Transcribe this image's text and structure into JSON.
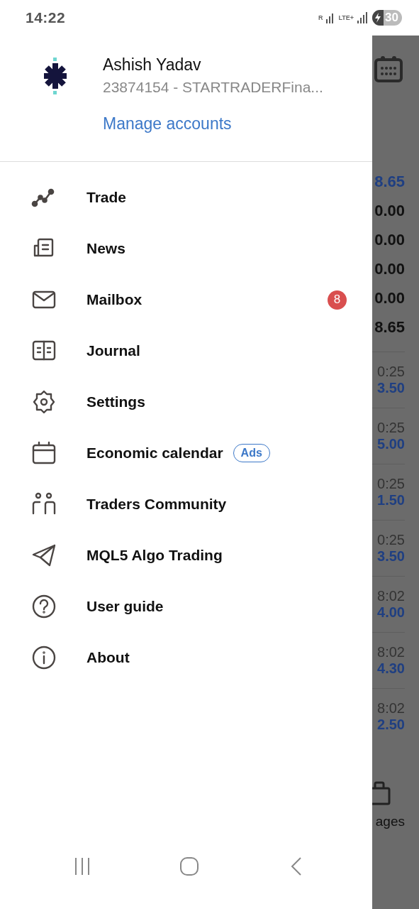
{
  "status_bar": {
    "time": "14:22",
    "roaming": "R",
    "network": "LTE+",
    "battery": "30"
  },
  "account": {
    "name": "Ashish Yadav",
    "number": "23874154 - STARTRADERFina...",
    "manage": "Manage accounts"
  },
  "menu": [
    {
      "label": "Trade"
    },
    {
      "label": "News"
    },
    {
      "label": "Mailbox",
      "badge": "8"
    },
    {
      "label": "Journal"
    },
    {
      "label": "Settings"
    },
    {
      "label": "Economic calendar",
      "tag": "Ads"
    },
    {
      "label": "Traders Community"
    },
    {
      "label": "MQL5 Algo Trading"
    },
    {
      "label": "User guide"
    },
    {
      "label": "About"
    }
  ],
  "background": {
    "summary": [
      {
        "value": "8.65",
        "kind": "link"
      },
      {
        "value": "0.00",
        "kind": "plain"
      },
      {
        "value": "0.00",
        "kind": "plain"
      },
      {
        "value": "0.00",
        "kind": "plain"
      },
      {
        "value": "0.00",
        "kind": "plain"
      },
      {
        "value": "8.65",
        "kind": "plain"
      }
    ],
    "rows": [
      {
        "time": "0:25",
        "price": "3.50"
      },
      {
        "time": "0:25",
        "price": "5.00"
      },
      {
        "time": "0:25",
        "price": "1.50"
      },
      {
        "time": "0:25",
        "price": "3.50"
      },
      {
        "time": "8:02",
        "price": "4.00"
      },
      {
        "time": "8:02",
        "price": "4.30"
      },
      {
        "time": "8:02",
        "price": "2.50"
      }
    ],
    "tab_label": "ages"
  }
}
